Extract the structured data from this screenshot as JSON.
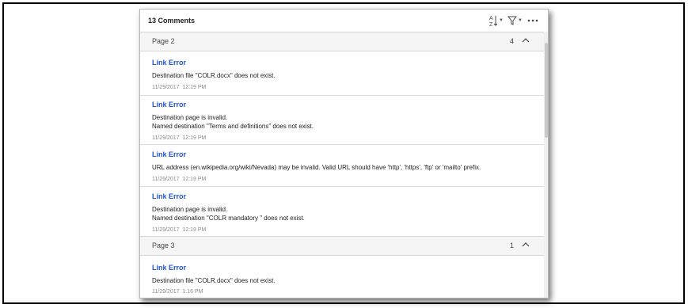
{
  "header": {
    "title": "13 Comments",
    "sort_icon": "sort-az-icon",
    "filter_icon": "filter-icon",
    "more_icon": "more-options-icon"
  },
  "groups": [
    {
      "label": "Page 2",
      "count": "4",
      "comments": [
        {
          "title": "Link Error",
          "body": "Destination file \"COLR.docx\" does not exist.",
          "date": "11/29/2017",
          "time": "12:19 PM"
        },
        {
          "title": "Link Error",
          "body": "Destination page is invalid.\nNamed destination \"Terms and definitions\" does not exist.",
          "date": "11/29/2017",
          "time": "12:19 PM"
        },
        {
          "title": "Link Error",
          "body": "URL address (en.wikipedia.org/wiki/Nevada) may be invalid. Valid URL should have 'http', 'https', 'ftp' or 'mailto' prefix.",
          "date": "11/29/2017",
          "time": "12:19 PM"
        },
        {
          "title": "Link Error",
          "body": "Destination page is invalid.\nNamed destination \"COLR mandatory \" does not exist.",
          "date": "11/29/2017",
          "time": "12:19 PM"
        }
      ]
    },
    {
      "label": "Page 3",
      "count": "1",
      "comments": [
        {
          "title": "Link Error",
          "body": "Destination file \"COLR.docx\" does not exist.",
          "date": "11/29/2017",
          "time": "1:16 PM"
        }
      ]
    }
  ],
  "colors": {
    "link_title": "#2255cc",
    "date_text": "#8a8a8a"
  }
}
